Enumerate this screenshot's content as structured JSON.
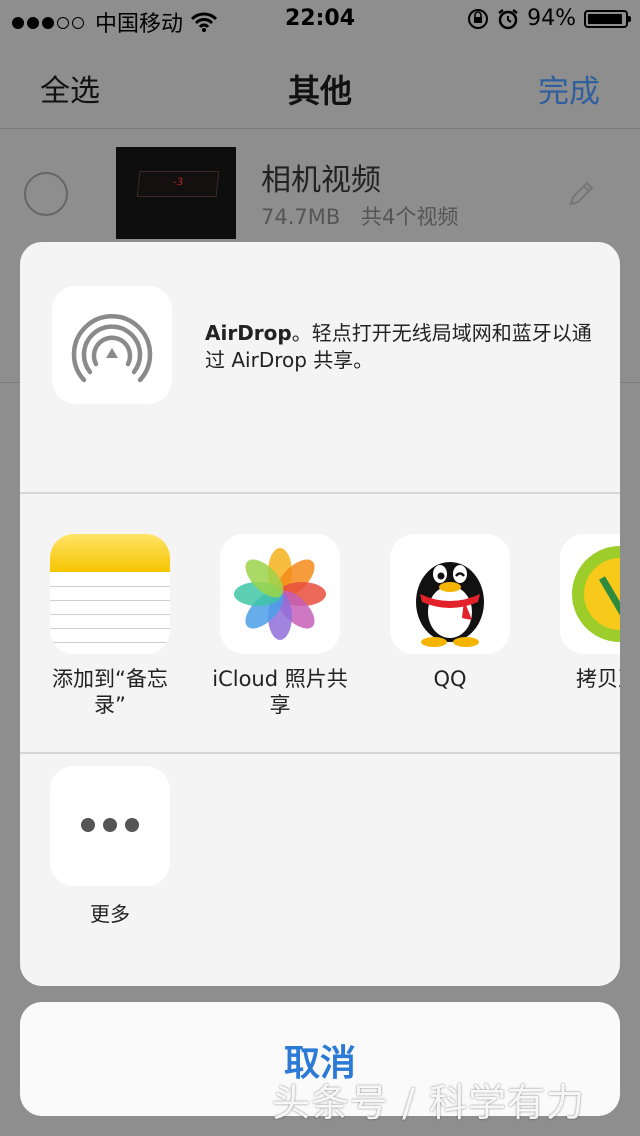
{
  "status_bar": {
    "carrier": "中国移动",
    "time": "22:04",
    "battery": "94%",
    "battery_level": 0.94
  },
  "nav": {
    "select_all": "全选",
    "title": "其他",
    "done": "完成"
  },
  "list_item": {
    "name": "相机视频",
    "size": "74.7MB",
    "count": "共4个视频",
    "thumb_text": "-3"
  },
  "share_sheet": {
    "airdrop_title": "AirDrop",
    "airdrop_desc": "。轻点打开无线局域网和蓝牙以通过 AirDrop 共享。",
    "apps": [
      {
        "label": "添加到“备忘录”",
        "icon": "notes-icon"
      },
      {
        "label": "iCloud 照片共享",
        "icon": "photos-icon"
      },
      {
        "label": "QQ",
        "icon": "qq-icon"
      },
      {
        "label": "拷贝至",
        "icon": "app-icon"
      }
    ],
    "more_label": "更多",
    "cancel": "取消"
  },
  "watermark": "头条号 / 科学有力",
  "colors": {
    "accent": "#2a7ad6",
    "nav_done": "#2f5f9e",
    "dim_background": "#8e8e8e"
  }
}
